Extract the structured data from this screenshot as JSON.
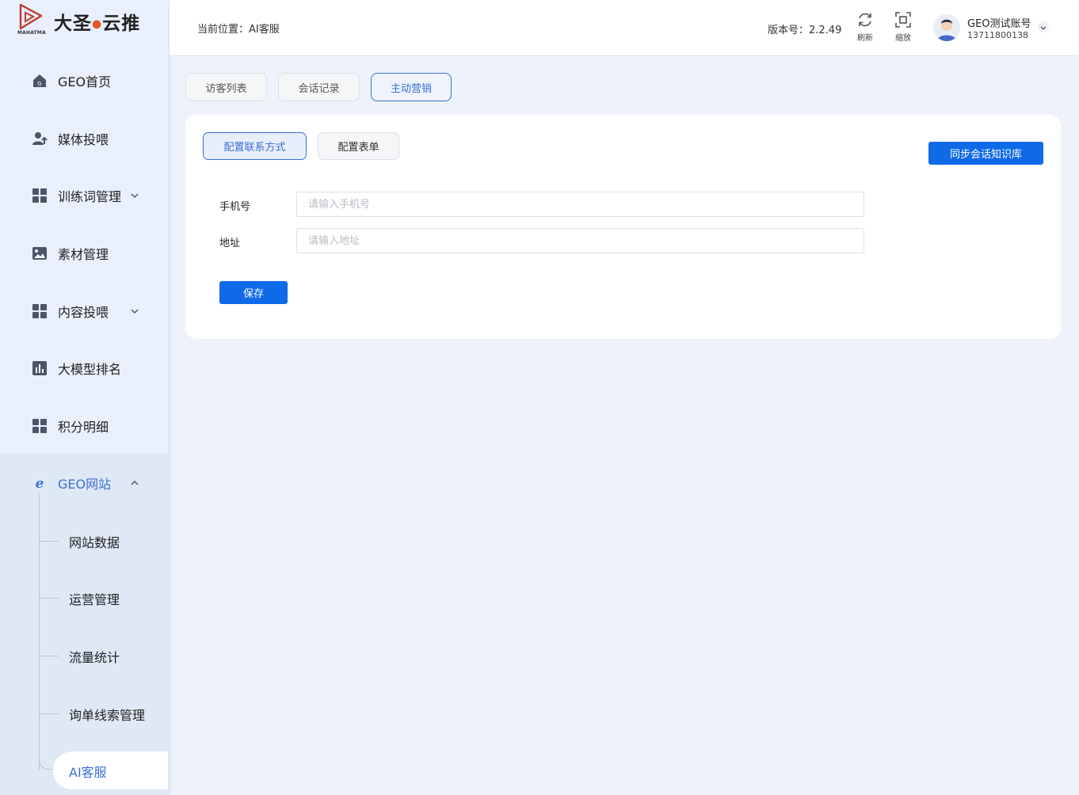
{
  "brand": {
    "name": "大圣",
    "name_suffix": "云推",
    "sub": "MAHATMA"
  },
  "sidebar": {
    "items": [
      {
        "label": "GEO首页",
        "icon": "home-icon"
      },
      {
        "label": "媒体投喂",
        "icon": "user-upload-icon"
      },
      {
        "label": "训练词管理",
        "icon": "grid-icon",
        "expandable": true
      },
      {
        "label": "素材管理",
        "icon": "image-icon"
      },
      {
        "label": "内容投喂",
        "icon": "grid-icon",
        "expandable": true
      },
      {
        "label": "大模型排名",
        "icon": "bar-chart-icon"
      },
      {
        "label": "积分明细",
        "icon": "grid-icon"
      },
      {
        "label": "GEO网站",
        "icon": "browser-e-icon",
        "expanded": true
      }
    ],
    "sub_items": [
      {
        "label": "网站数据"
      },
      {
        "label": "运营管理"
      },
      {
        "label": "流量统计"
      },
      {
        "label": "询单线索管理"
      },
      {
        "label": "AI客服",
        "current": true
      }
    ],
    "accent_color": "#3c6fd6"
  },
  "header": {
    "breadcrumb": "当前位置：AI客服",
    "version": "版本号：2.2.49",
    "refresh_label": "刷新",
    "zoom_label": "缩放",
    "user_name": "GEO测试账号",
    "user_phone": "13711800138"
  },
  "tabs": [
    {
      "label": "访客列表"
    },
    {
      "label": "会话记录"
    },
    {
      "label": "主动营销",
      "active": true
    }
  ],
  "panel": {
    "subtabs": [
      {
        "label": "配置联系方式",
        "active": true
      },
      {
        "label": "配置表单"
      }
    ],
    "sync_button": "同步会话知识库",
    "fields": [
      {
        "label": "手机号",
        "value": "",
        "placeholder": "请输入手机号"
      },
      {
        "label": "地址",
        "value": "",
        "placeholder": "请输入地址"
      }
    ],
    "save_button": "保存",
    "primary_color": "#0f6ae8"
  }
}
